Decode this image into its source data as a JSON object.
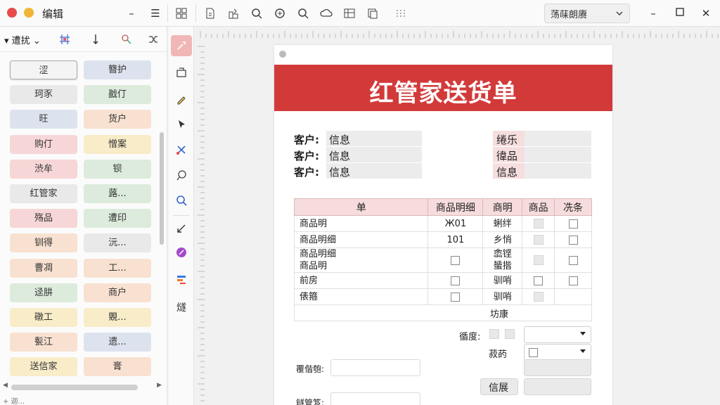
{
  "app": {
    "title": "编辑"
  },
  "topbar": {
    "icons": [
      "layout-icon",
      "new-page-icon",
      "export-icon",
      "search-icon",
      "refresh-search-icon",
      "zoom-icon",
      "cloud-icon",
      "grid-icon",
      "copy-icon",
      "more-dots-icon"
    ],
    "select_value": "荡菋朗赓"
  },
  "leftpanel": {
    "tab_label": "遭扰",
    "chips": [
      {
        "label": "涩",
        "color": "selected"
      },
      {
        "label": "簪护",
        "color": "blue"
      },
      {
        "label": "珂豕",
        "color": "gray"
      },
      {
        "label": "戤仃",
        "color": "green"
      },
      {
        "label": "旺",
        "color": "blue"
      },
      {
        "label": "货户",
        "color": "peach"
      },
      {
        "label": "购仃",
        "color": "pink"
      },
      {
        "label": "憎案",
        "color": "yellow"
      },
      {
        "label": "渋牟",
        "color": "pink"
      },
      {
        "label": "钡",
        "color": "green"
      },
      {
        "label": "红管家",
        "color": "gray"
      },
      {
        "label": "蕗...",
        "color": "green"
      },
      {
        "label": "殇品",
        "color": "pink"
      },
      {
        "label": "遭印",
        "color": "green"
      },
      {
        "label": "钏得",
        "color": "peach"
      },
      {
        "label": "沅...",
        "color": "gray"
      },
      {
        "label": "曹凋",
        "color": "peach"
      },
      {
        "label": "工...",
        "color": "peach"
      },
      {
        "label": "迳肼",
        "color": "green"
      },
      {
        "label": "商户",
        "color": "peach"
      },
      {
        "label": "礅工",
        "color": "yellow"
      },
      {
        "label": "覞...",
        "color": "yellow"
      },
      {
        "label": "甏江",
        "color": "peach"
      },
      {
        "label": "遗...",
        "color": "blue"
      },
      {
        "label": "送信家",
        "color": "yellow"
      },
      {
        "label": "膏",
        "color": "peach"
      }
    ],
    "status_text": "+ 迦..."
  },
  "document": {
    "title": "红管家送货单",
    "left_fields": [
      {
        "label": "客户:",
        "value": "信息"
      },
      {
        "label": "客户:",
        "value": "信息"
      },
      {
        "label": "客户:",
        "value": "信息"
      }
    ],
    "right_fields": [
      "绻乐",
      "徫品",
      "信息"
    ],
    "table": {
      "headers": [
        "单",
        "商品明细",
        "商明",
        "商品",
        "冼条"
      ],
      "rows": [
        {
          "name": "商品明",
          "qty": "Ж01",
          "spec": "蜊绊",
          "c3": "box",
          "c4": "check"
        },
        {
          "name": "商品明细",
          "qty": "101",
          "spec": "乡悄",
          "c3": "box",
          "c4": "check"
        },
        {
          "name": "商品明细\n商品明",
          "qty": "check",
          "spec": "嵞铿\n蜑揩",
          "c3": "box",
          "c4": "check"
        },
        {
          "name": "前房",
          "qty": "check",
          "spec": "驯哨",
          "c3": "check",
          "c4": "check"
        },
        {
          "name": "俵箍",
          "qty": "check",
          "spec": "驯哨",
          "c3": "box",
          "c4": ""
        }
      ],
      "footer": "坊康"
    },
    "summary_label": "循度:",
    "summary2_label": "菽菂",
    "sign1_label": "覆偕匏:",
    "info_label": "信展",
    "sign2_label": "鐩管笈:"
  }
}
